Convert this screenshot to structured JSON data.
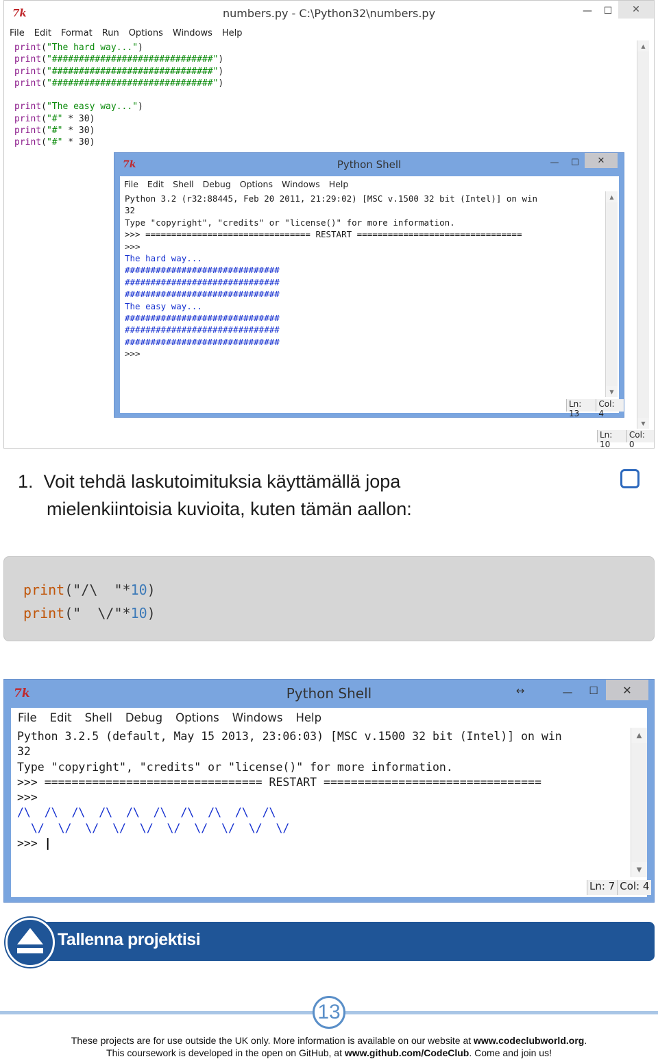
{
  "editor": {
    "title": "numbers.py - C:\\Python32\\numbers.py",
    "menu": [
      "File",
      "Edit",
      "Format",
      "Run",
      "Options",
      "Windows",
      "Help"
    ],
    "lines": [
      [
        "print",
        "(",
        "\"The hard way...\"",
        ")"
      ],
      [
        "print",
        "(",
        "\"##############################\"",
        ")"
      ],
      [
        "print",
        "(",
        "\"##############################\"",
        ")"
      ],
      [
        "print",
        "(",
        "\"##############################\"",
        ")"
      ],
      [
        "",
        "",
        "",
        ""
      ],
      [
        "print",
        "(",
        "\"The easy way...\"",
        ")"
      ],
      [
        "print",
        "(",
        "\"#\"",
        " * 30)"
      ],
      [
        "print",
        "(",
        "\"#\"",
        " * 30)"
      ],
      [
        "print",
        "(",
        "\"#\"",
        " * 30)"
      ]
    ],
    "status": {
      "ln": "Ln: 10",
      "col": "Col: 0"
    }
  },
  "shell1": {
    "title": "Python Shell",
    "menu": [
      "File",
      "Edit",
      "Shell",
      "Debug",
      "Options",
      "Windows",
      "Help"
    ],
    "header": [
      "Python 3.2 (r32:88445, Feb 20 2011, 21:29:02) [MSC v.1500 32 bit (Intel)] on win",
      "32",
      "Type \"copyright\", \"credits\" or \"license()\" for more information."
    ],
    "restart": ">>> ================================ RESTART ================================",
    "prompt": ">>>",
    "output": [
      "The hard way...",
      "##############################",
      "##############################",
      "##############################",
      "The easy way...",
      "##############################",
      "##############################",
      "##############################"
    ],
    "status": {
      "ln": "Ln: 13",
      "col": "Col: 4"
    }
  },
  "step": {
    "number": "1.",
    "line1": "Voit tehdä laskutoimituksia käyttämällä jopa",
    "line2": "mielenkiintoisia kuvioita, kuten tämän aallon:"
  },
  "codeblock": {
    "line1": {
      "fn": "print",
      "open": "(",
      "str": "\"/\\  \"",
      "op": "*",
      "num": "10",
      "close": ")"
    },
    "line2": {
      "fn": "print",
      "open": "(",
      "str": "\"  \\/\"",
      "op": "*",
      "num": "10",
      "close": ")"
    }
  },
  "shell2": {
    "title": "Python Shell",
    "menu": [
      "File",
      "Edit",
      "Shell",
      "Debug",
      "Options",
      "Windows",
      "Help"
    ],
    "header": [
      "Python 3.2.5 (default, May 15 2013, 23:06:03) [MSC v.1500 32 bit (Intel)] on win",
      "32",
      "Type \"copyright\", \"credits\" or \"license()\" for more information."
    ],
    "restart": ">>> ================================ RESTART ================================",
    "prompt": ">>>",
    "output": [
      "/\\  /\\  /\\  /\\  /\\  /\\  /\\  /\\  /\\  /\\  ",
      "  \\/  \\/  \\/  \\/  \\/  \\/  \\/  \\/  \\/  \\/"
    ],
    "final_prompt": ">>> ",
    "status": {
      "ln": "Ln: 7",
      "col": "Col: 4"
    }
  },
  "banner": {
    "label": "Tallenna projektisi"
  },
  "footer": {
    "page": "13",
    "line1_pre": "These projects are for use outside the UK only. More information is available on our website at ",
    "line1_link": "www.codeclubworld.org",
    "line1_post": ".",
    "line2_pre": "This coursework is developed in the open on GitHub, at ",
    "line2_link": "www.github.com/CodeClub",
    "line2_post": ". Come and join us!"
  },
  "colors": {
    "accent": "#1f5597",
    "idle_border": "#7aa5df",
    "checkbox": "#2d69bd"
  }
}
